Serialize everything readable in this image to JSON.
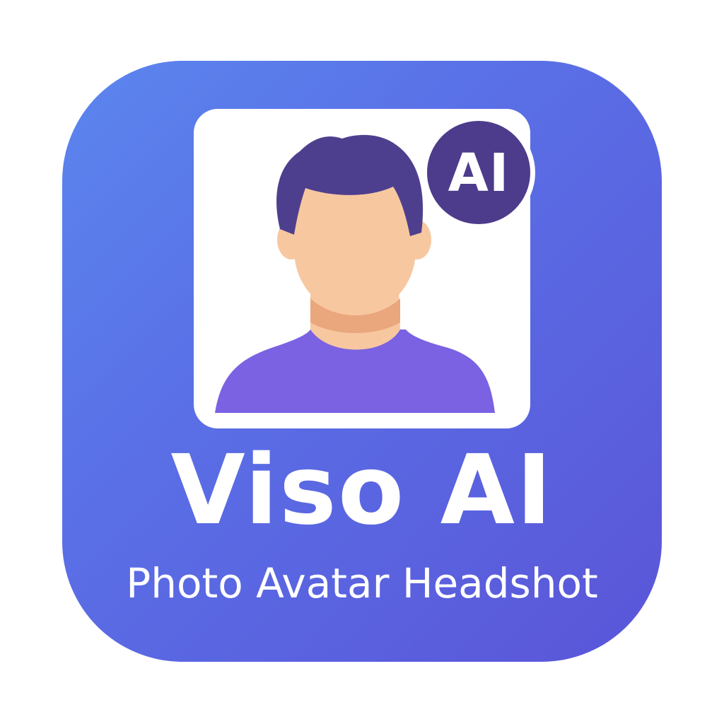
{
  "app": {
    "name": "Viso AI",
    "tagline": "Photo Avatar Headshot",
    "badge_text": "AI"
  },
  "icons": {
    "avatar": "person-avatar-icon",
    "badge": "ai-badge-icon"
  },
  "colors": {
    "gradient_start": "#5b86ee",
    "gradient_end": "#5a55d8",
    "badge": "#4d3b8c",
    "hair": "#4e3f8e",
    "skin": "#f7c7a0",
    "neck_shadow": "#eaa67c",
    "shirt": "#7a62e2",
    "text": "#ffffff"
  }
}
